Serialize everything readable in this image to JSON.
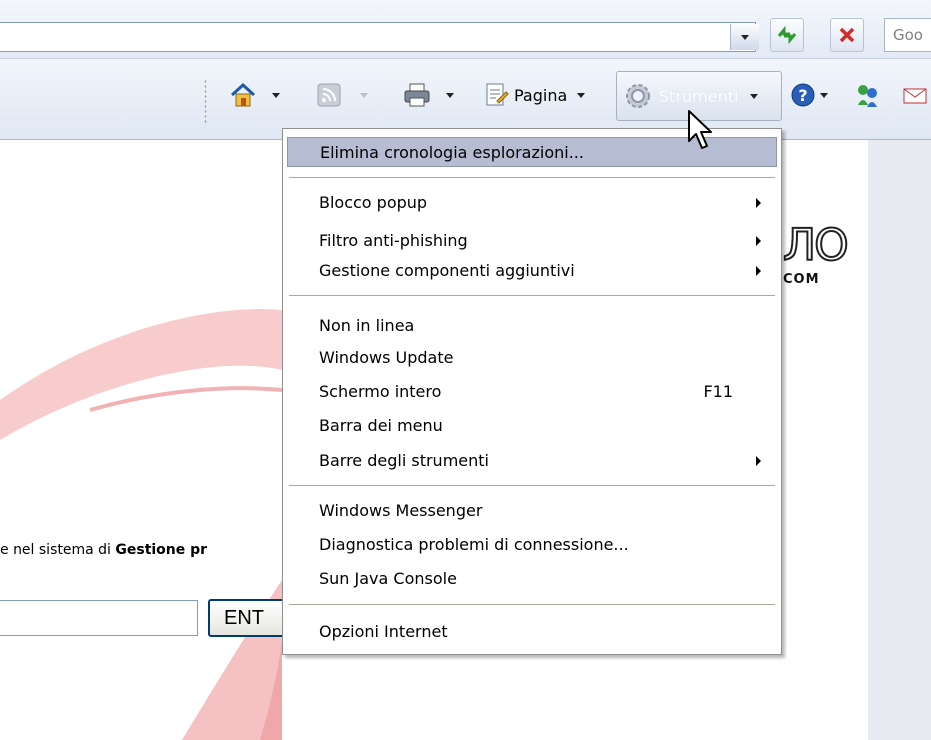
{
  "address_bar": {
    "search_placeholder": "Goo"
  },
  "toolbar": {
    "page_label": "Pagina",
    "tools_label": "Strumenti"
  },
  "page": {
    "intro_prefix": "e nel sistema di ",
    "intro_bold": "Gestione pr",
    "enter_button_label": "ENT",
    "logo_fragment": "ЛО",
    "logo_com": "COM"
  },
  "menu": {
    "items": [
      {
        "label": "Elimina cronologia esplorazioni...",
        "highlighted": true
      },
      {
        "label": "Blocco popup",
        "submenu": true
      },
      {
        "label": "Filtro anti-phishing",
        "submenu": true
      },
      {
        "label": "Gestione componenti aggiuntivi",
        "submenu": true
      },
      {
        "label": "Non in linea"
      },
      {
        "label": "Windows Update"
      },
      {
        "label": "Schermo intero",
        "shortcut": "F11"
      },
      {
        "label": "Barra dei menu"
      },
      {
        "label": "Barre degli strumenti",
        "submenu": true
      },
      {
        "label": "Windows Messenger"
      },
      {
        "label": "Diagnostica problemi di connessione..."
      },
      {
        "label": "Sun Java Console"
      },
      {
        "label": "Opzioni Internet"
      }
    ]
  },
  "colors": {
    "menu_highlight": "#b6bdd2",
    "swoosh": "#e0282e"
  }
}
